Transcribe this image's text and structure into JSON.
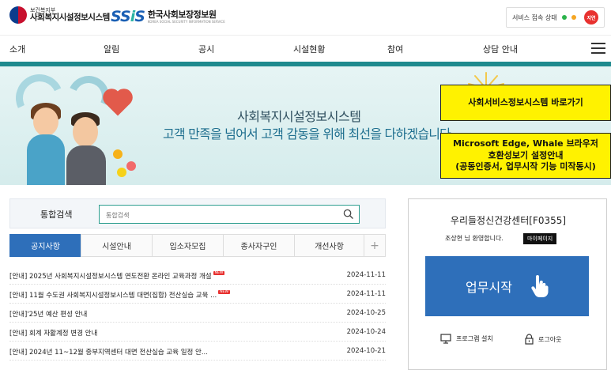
{
  "header": {
    "ministry_small": "보건복지부",
    "ministry_name": "사회복지시설정보시스템",
    "ssis_logo": "SSiS",
    "agency_name": "한국사회보장정보원",
    "agency_english": "KOREA SOCIAL SECURITY INFORMATION SERVICE",
    "service_status_label": "서비스 접속 상태",
    "status_colors": [
      "#2bb34b",
      "#f5a623"
    ],
    "status_badge": "지연"
  },
  "nav": {
    "items": [
      "소개",
      "알림",
      "공시",
      "시설현황",
      "참여",
      "상담 안내"
    ],
    "menu_icon": "hamburger-icon"
  },
  "banner": {
    "title": "사회복지시설정보시스템",
    "slogan": "고객 만족을 넘어서 고객 감동을 위해 최선을 다하겠습니다",
    "link_button": "사회서비스정보시스템 바로가기",
    "edge_notice_lines": [
      "Microsoft Edge, Whale 브라우저",
      "호환성보기 설정안내",
      "(공동인증서, 업무시작 기능 미작동시)"
    ]
  },
  "search": {
    "label": "통합검색",
    "placeholder": "통합검색",
    "icon": "search-icon"
  },
  "tabs": {
    "items": [
      "공지사항",
      "시설안내",
      "입소자모집",
      "종사자구인",
      "개선사항"
    ],
    "active_index": 0,
    "more": "+"
  },
  "notices": [
    {
      "title": "[안내] 2025년 사회복지시설정보시스템 연도전환 온라인 교육과정 개설",
      "date": "2024-11-11",
      "is_new": true
    },
    {
      "title": "[안내] 11월 수도권 사회복지시설정보시스템 대면(집합) 전산실습 교육 ...",
      "date": "2024-11-11",
      "is_new": true
    },
    {
      "title": "[안내]'25년 예산 편성 안내",
      "date": "2024-10-25",
      "is_new": false
    },
    {
      "title": "[안내] 회계 자활계정 변경 안내",
      "date": "2024-10-24",
      "is_new": false
    },
    {
      "title": "[안내] 2024년 11~12월 중부지역센터 대면 전산실습 교육 일정 안...",
      "date": "2024-10-21",
      "is_new": false
    }
  ],
  "new_badge": "NEW",
  "user_panel": {
    "center_name": "우리들정신건강센터[F0355]",
    "welcome": "조상현 님 환영합니다.",
    "mypage_button": "마이페이지",
    "start_button": "업무시작",
    "program_install": "프로그램 설치",
    "logout": "로그아웃"
  },
  "colors": {
    "accent_teal": "#1f8a8e",
    "primary_blue": "#2e6fba",
    "highlight_yellow": "#fff200",
    "status_red": "#e8312f"
  }
}
